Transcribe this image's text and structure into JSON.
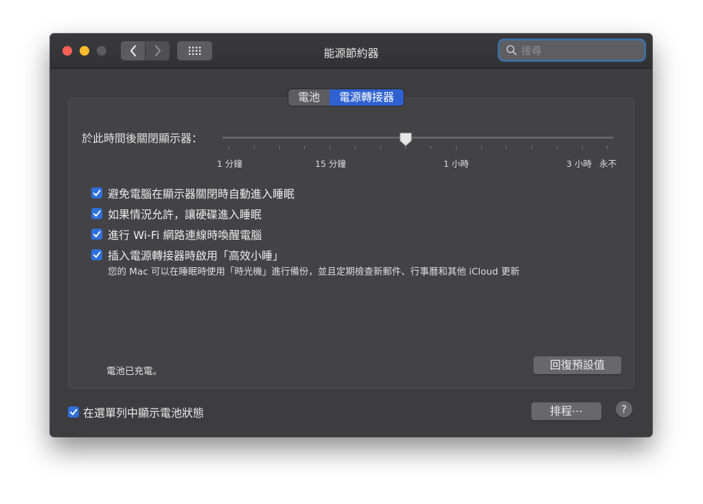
{
  "window": {
    "title": "能源節約器"
  },
  "titlebar": {
    "back_icon": "chevron-left-icon",
    "forward_icon": "chevron-right-icon",
    "grid_icon": "grid-icon",
    "search_placeholder": "搜尋"
  },
  "tabs": [
    {
      "label": "電池",
      "selected": false
    },
    {
      "label": "電源轉接器",
      "selected": true
    }
  ],
  "display_sleep": {
    "label": "於此時間後關閉顯示器：",
    "tick_labels": [
      "1 分鐘",
      "15 分鐘",
      "1 小時",
      "3 小時",
      "永不"
    ],
    "value_fraction": 0.47
  },
  "options": [
    {
      "label": "避免電腦在顯示器關閉時自動進入睡眠",
      "checked": true
    },
    {
      "label": "如果情況允許，讓硬碟進入睡眠",
      "checked": true
    },
    {
      "label": "進行 Wi-Fi 網路連線時喚醒電腦",
      "checked": true
    },
    {
      "label": "插入電源轉接器時啟用「高效小睡」",
      "checked": true
    }
  ],
  "power_nap_description": "您的 Mac 可以在睡眠時使用「時光機」進行備份，並且定期檢查新郵件、行事曆和其他 iCloud 更新",
  "battery_status": "電池已充電。",
  "buttons": {
    "restore_defaults": "回復預設值",
    "schedule": "排程⋯",
    "help": "?"
  },
  "menu_bar_option": {
    "label": "在選單列中顯示電池狀態",
    "checked": true
  },
  "colors": {
    "accent": "#2f61d0",
    "checkbox": "#2f6fdb",
    "close": "#ff5f57",
    "minimize": "#febc2e"
  }
}
